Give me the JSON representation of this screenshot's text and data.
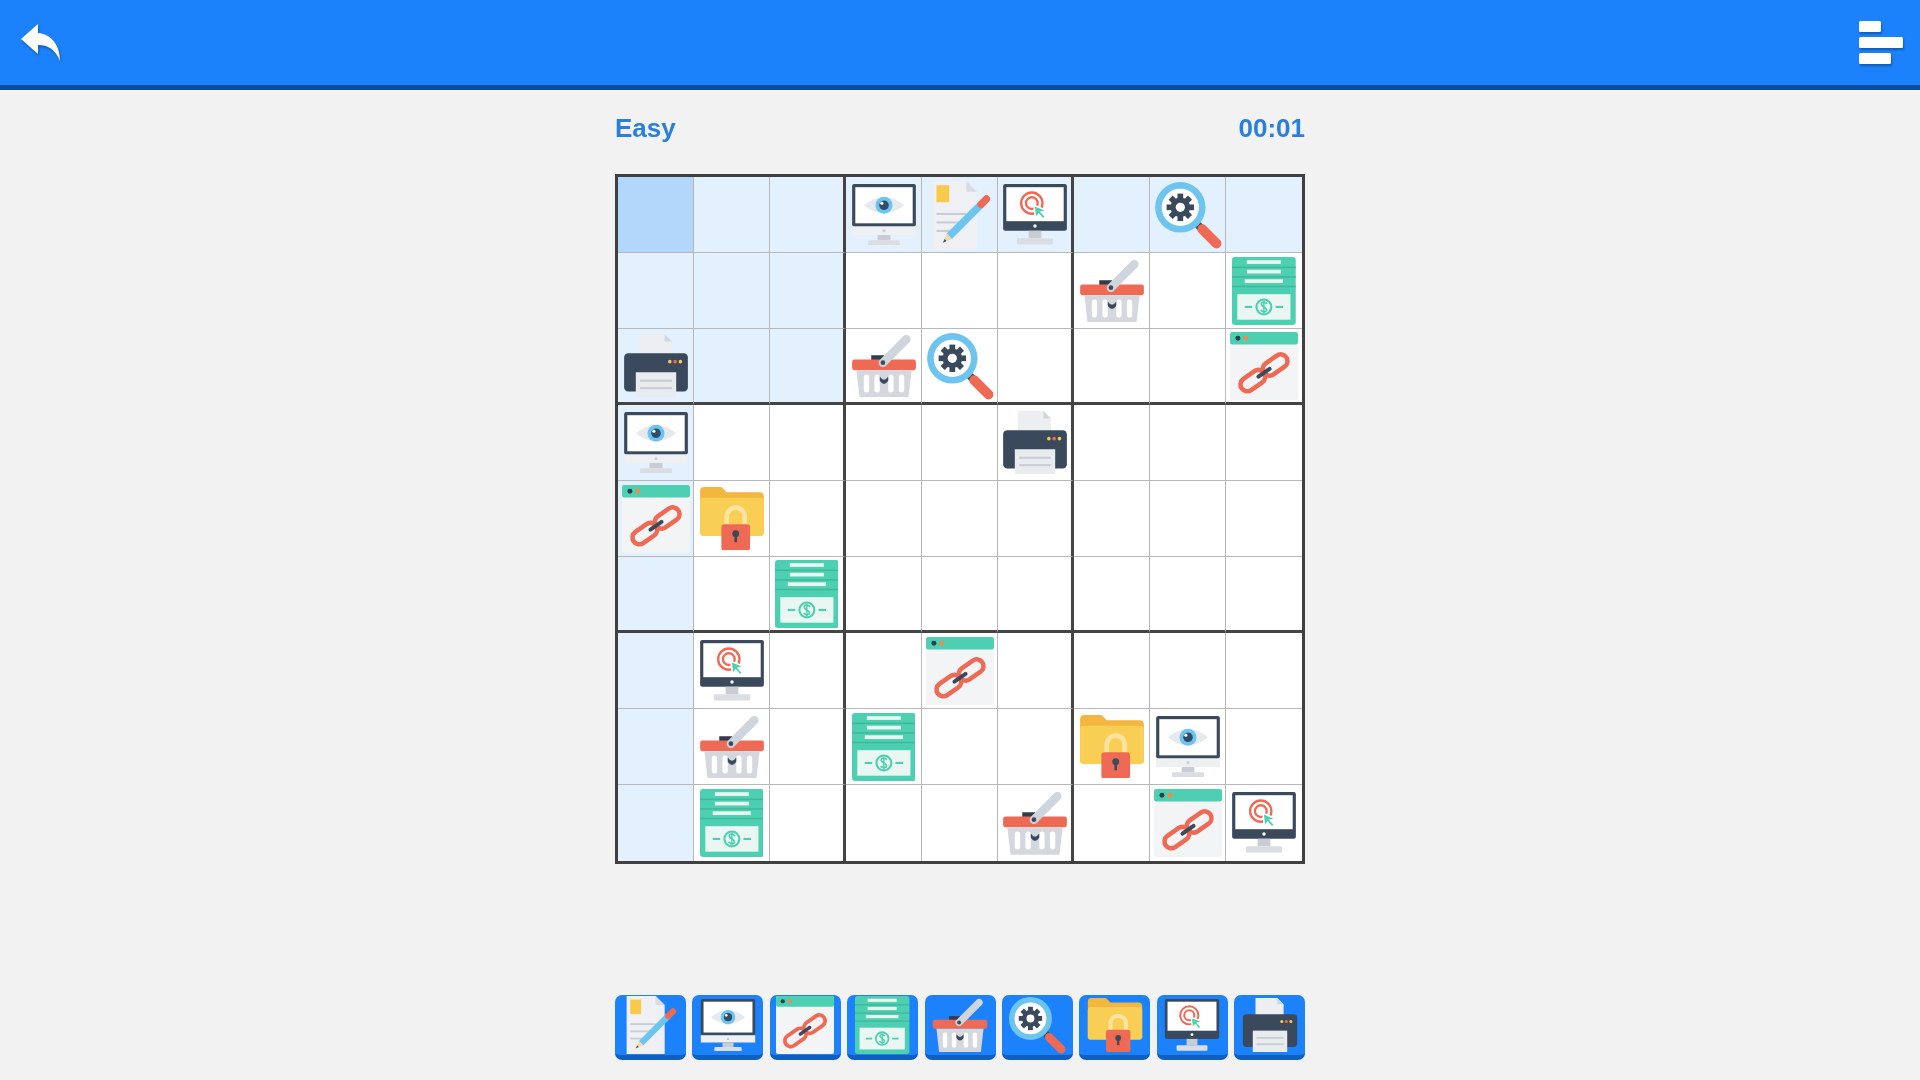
{
  "difficulty": "Easy",
  "timer": "00:01",
  "grid": {
    "rows": [
      {
        "cells": [
          {
            "kind": "empty",
            "selected": true,
            "highlighted": true
          },
          {
            "kind": "empty",
            "selected": false,
            "highlighted": true
          },
          {
            "kind": "empty",
            "selected": false,
            "highlighted": true
          },
          {
            "kind": "eye",
            "selected": false,
            "highlighted": true
          },
          {
            "kind": "document",
            "selected": false,
            "highlighted": true
          },
          {
            "kind": "target",
            "selected": false,
            "highlighted": true
          },
          {
            "kind": "empty",
            "selected": false,
            "highlighted": true
          },
          {
            "kind": "gear",
            "selected": false,
            "highlighted": true
          },
          {
            "kind": "empty",
            "selected": false,
            "highlighted": true
          }
        ]
      },
      {
        "cells": [
          {
            "kind": "empty",
            "selected": false,
            "highlighted": true
          },
          {
            "kind": "empty",
            "selected": false,
            "highlighted": true
          },
          {
            "kind": "empty",
            "selected": false,
            "highlighted": true
          },
          {
            "kind": "empty",
            "selected": false,
            "highlighted": false
          },
          {
            "kind": "empty",
            "selected": false,
            "highlighted": false
          },
          {
            "kind": "empty",
            "selected": false,
            "highlighted": false
          },
          {
            "kind": "basket",
            "selected": false,
            "highlighted": false
          },
          {
            "kind": "empty",
            "selected": false,
            "highlighted": false
          },
          {
            "kind": "cash",
            "selected": false,
            "highlighted": false
          }
        ]
      },
      {
        "cells": [
          {
            "kind": "printer",
            "selected": false,
            "highlighted": true
          },
          {
            "kind": "empty",
            "selected": false,
            "highlighted": true
          },
          {
            "kind": "empty",
            "selected": false,
            "highlighted": true
          },
          {
            "kind": "basket",
            "selected": false,
            "highlighted": false
          },
          {
            "kind": "gear",
            "selected": false,
            "highlighted": false
          },
          {
            "kind": "empty",
            "selected": false,
            "highlighted": false
          },
          {
            "kind": "empty",
            "selected": false,
            "highlighted": false
          },
          {
            "kind": "empty",
            "selected": false,
            "highlighted": false
          },
          {
            "kind": "link",
            "selected": false,
            "highlighted": false
          }
        ]
      },
      {
        "cells": [
          {
            "kind": "eye",
            "selected": false,
            "highlighted": true
          },
          {
            "kind": "empty",
            "selected": false,
            "highlighted": false
          },
          {
            "kind": "empty",
            "selected": false,
            "highlighted": false
          },
          {
            "kind": "empty",
            "selected": false,
            "highlighted": false
          },
          {
            "kind": "empty",
            "selected": false,
            "highlighted": false
          },
          {
            "kind": "printer",
            "selected": false,
            "highlighted": false
          },
          {
            "kind": "empty",
            "selected": false,
            "highlighted": false
          },
          {
            "kind": "empty",
            "selected": false,
            "highlighted": false
          },
          {
            "kind": "empty",
            "selected": false,
            "highlighted": false
          }
        ]
      },
      {
        "cells": [
          {
            "kind": "link",
            "selected": false,
            "highlighted": true
          },
          {
            "kind": "folder",
            "selected": false,
            "highlighted": false
          },
          {
            "kind": "empty",
            "selected": false,
            "highlighted": false
          },
          {
            "kind": "empty",
            "selected": false,
            "highlighted": false
          },
          {
            "kind": "empty",
            "selected": false,
            "highlighted": false
          },
          {
            "kind": "empty",
            "selected": false,
            "highlighted": false
          },
          {
            "kind": "empty",
            "selected": false,
            "highlighted": false
          },
          {
            "kind": "empty",
            "selected": false,
            "highlighted": false
          },
          {
            "kind": "empty",
            "selected": false,
            "highlighted": false
          }
        ]
      },
      {
        "cells": [
          {
            "kind": "empty",
            "selected": false,
            "highlighted": true
          },
          {
            "kind": "empty",
            "selected": false,
            "highlighted": false
          },
          {
            "kind": "cash",
            "selected": false,
            "highlighted": false
          },
          {
            "kind": "empty",
            "selected": false,
            "highlighted": false
          },
          {
            "kind": "empty",
            "selected": false,
            "highlighted": false
          },
          {
            "kind": "empty",
            "selected": false,
            "highlighted": false
          },
          {
            "kind": "empty",
            "selected": false,
            "highlighted": false
          },
          {
            "kind": "empty",
            "selected": false,
            "highlighted": false
          },
          {
            "kind": "empty",
            "selected": false,
            "highlighted": false
          }
        ]
      },
      {
        "cells": [
          {
            "kind": "empty",
            "selected": false,
            "highlighted": true
          },
          {
            "kind": "target",
            "selected": false,
            "highlighted": false
          },
          {
            "kind": "empty",
            "selected": false,
            "highlighted": false
          },
          {
            "kind": "empty",
            "selected": false,
            "highlighted": false
          },
          {
            "kind": "link",
            "selected": false,
            "highlighted": false
          },
          {
            "kind": "empty",
            "selected": false,
            "highlighted": false
          },
          {
            "kind": "empty",
            "selected": false,
            "highlighted": false
          },
          {
            "kind": "empty",
            "selected": false,
            "highlighted": false
          },
          {
            "kind": "empty",
            "selected": false,
            "highlighted": false
          }
        ]
      },
      {
        "cells": [
          {
            "kind": "empty",
            "selected": false,
            "highlighted": true
          },
          {
            "kind": "basket",
            "selected": false,
            "highlighted": false
          },
          {
            "kind": "empty",
            "selected": false,
            "highlighted": false
          },
          {
            "kind": "cash",
            "selected": false,
            "highlighted": false
          },
          {
            "kind": "empty",
            "selected": false,
            "highlighted": false
          },
          {
            "kind": "empty",
            "selected": false,
            "highlighted": false
          },
          {
            "kind": "folder",
            "selected": false,
            "highlighted": false
          },
          {
            "kind": "eye",
            "selected": false,
            "highlighted": false
          },
          {
            "kind": "empty",
            "selected": false,
            "highlighted": false
          }
        ]
      },
      {
        "cells": [
          {
            "kind": "empty",
            "selected": false,
            "highlighted": true
          },
          {
            "kind": "cash",
            "selected": false,
            "highlighted": false
          },
          {
            "kind": "empty",
            "selected": false,
            "highlighted": false
          },
          {
            "kind": "empty",
            "selected": false,
            "highlighted": false
          },
          {
            "kind": "empty",
            "selected": false,
            "highlighted": false
          },
          {
            "kind": "basket",
            "selected": false,
            "highlighted": false
          },
          {
            "kind": "empty",
            "selected": false,
            "highlighted": false
          },
          {
            "kind": "link",
            "selected": false,
            "highlighted": false
          },
          {
            "kind": "target",
            "selected": false,
            "highlighted": false
          }
        ]
      }
    ]
  },
  "palette": [
    {
      "kind": "document"
    },
    {
      "kind": "eye"
    },
    {
      "kind": "link"
    },
    {
      "kind": "cash"
    },
    {
      "kind": "basket"
    },
    {
      "kind": "gear"
    },
    {
      "kind": "folder"
    },
    {
      "kind": "target"
    },
    {
      "kind": "printer"
    }
  ]
}
